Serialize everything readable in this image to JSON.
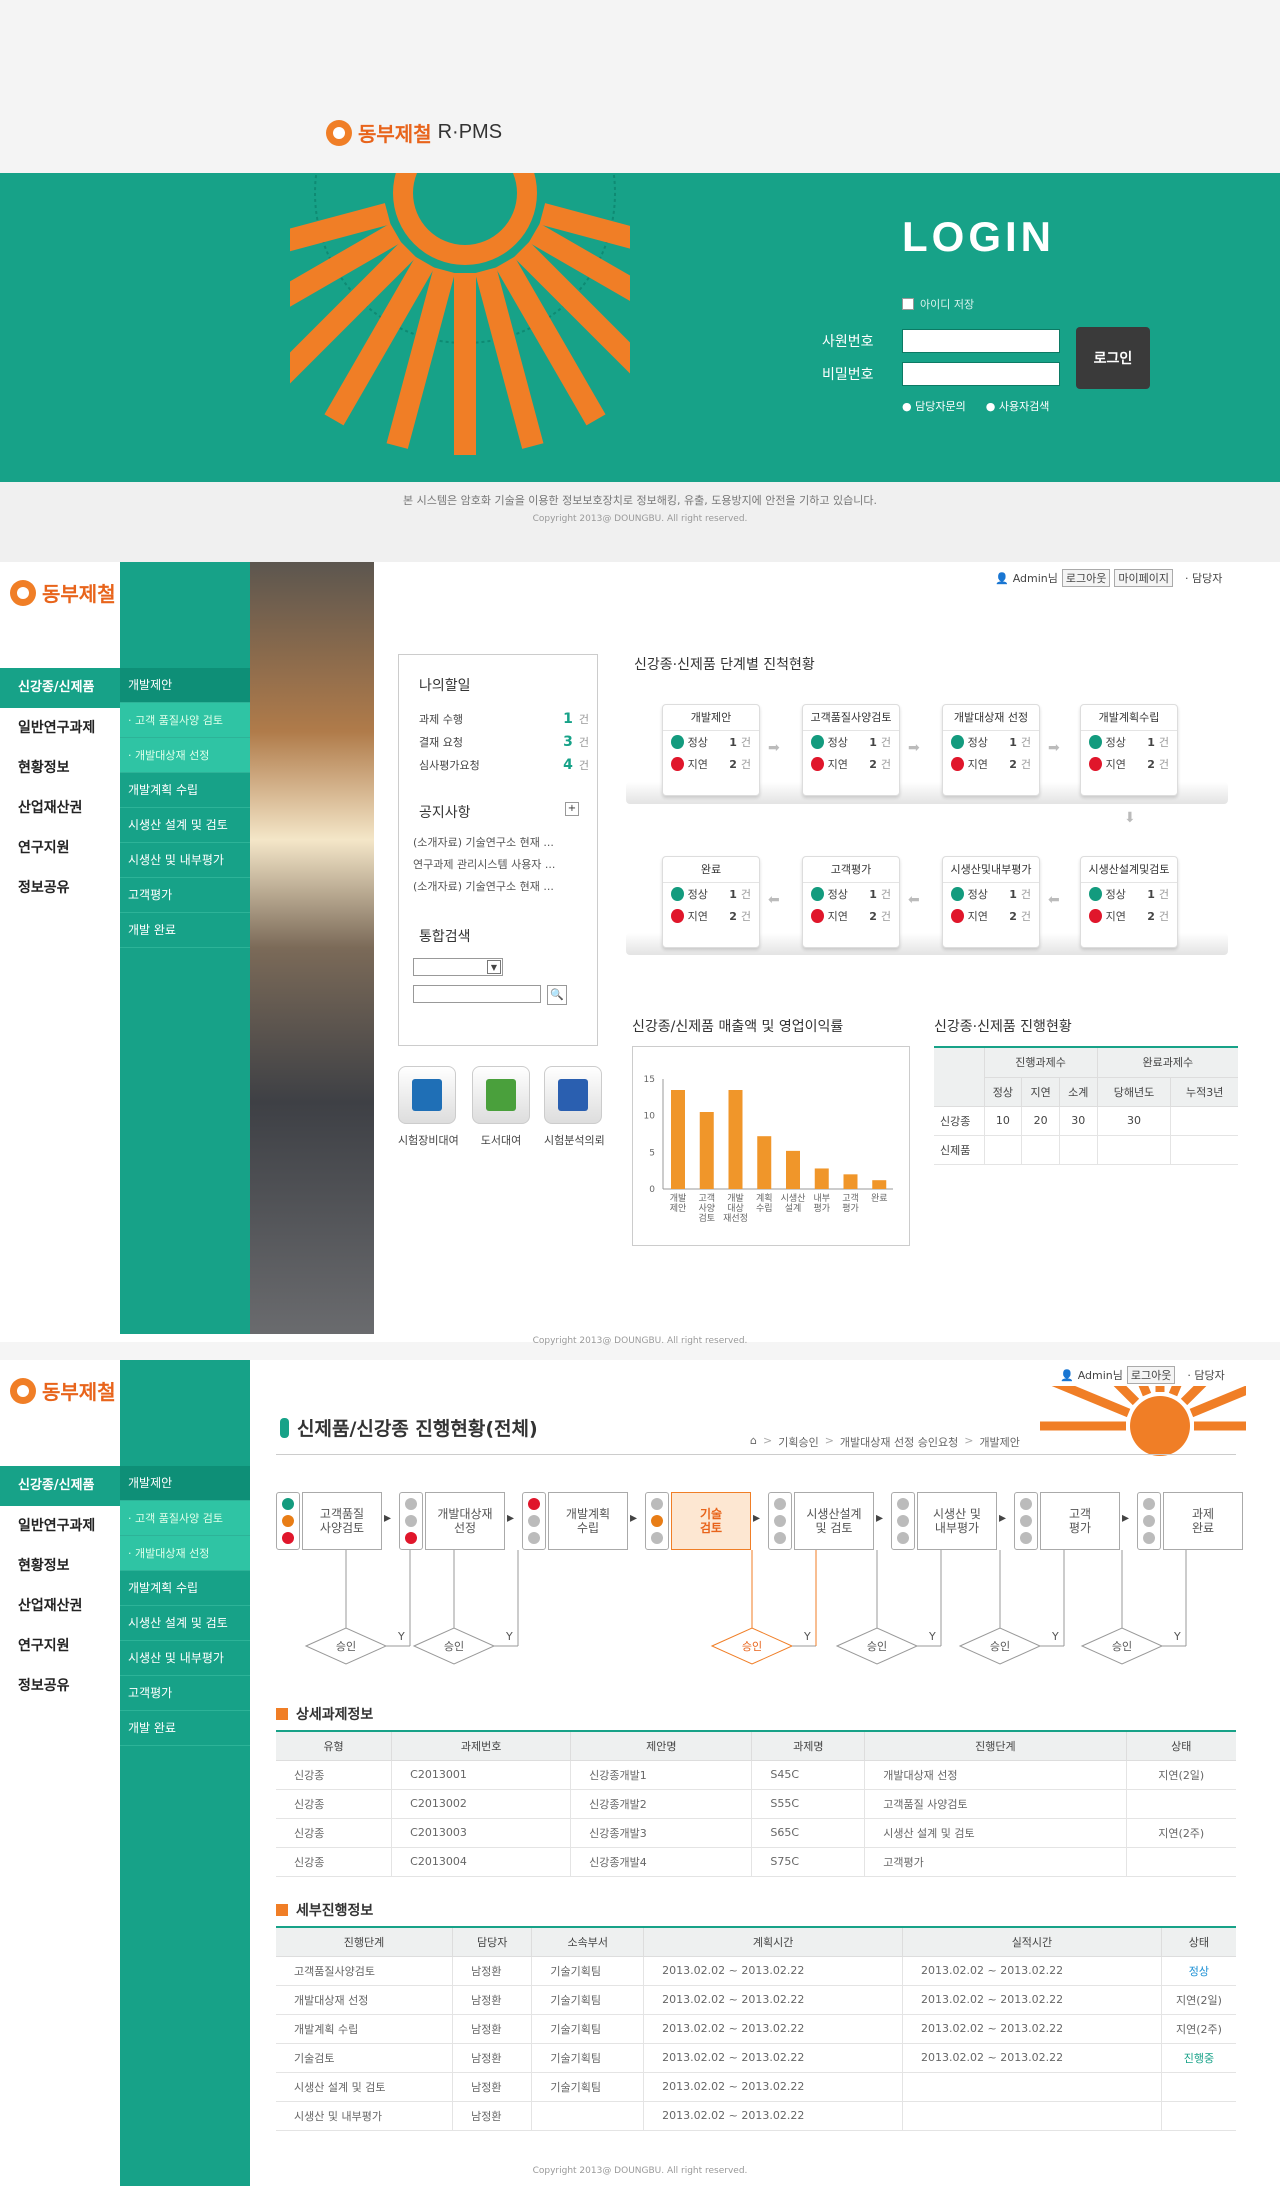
{
  "brand": {
    "name": "동부제철",
    "product": "R·PMS"
  },
  "login": {
    "title": "LOGIN",
    "save_id": "아이디 저장",
    "emp_label": "사원번호",
    "pw_label": "비밀번호",
    "login_button": "로그인",
    "contact": "담당자문의",
    "manual": "사용자검색",
    "notice": "본 시스템은 암호화 기술을 이용한 정보보호장치로 정보해킹, 유출, 도용방지에 안전을 기하고 있습니다.",
    "copyright": "Copyright 2013@ DOUNGBU. All right reserved."
  },
  "header": {
    "user": "Admin님",
    "logout": "로그아웃",
    "mypage": "마이페이지",
    "contact": "담당자"
  },
  "menu": {
    "main": [
      "신강종/신제품",
      "일반연구과제",
      "현황정보",
      "산업재산권",
      "연구지원",
      "정보공유"
    ],
    "sub": [
      "개발제안",
      "· 고객 품질사양 검토",
      "· 개발대상재 선정",
      "개발계획 수립",
      "시생산 설계 및 검토",
      "시생산 및 내부평가",
      "고객평가",
      "개발 완료"
    ]
  },
  "todo": {
    "title": "나의할일",
    "items": [
      {
        "label": "과제 수행",
        "count": "1",
        "unit": "건"
      },
      {
        "label": "결재 요청",
        "count": "3",
        "unit": "건"
      },
      {
        "label": "심사평가요청",
        "count": "4",
        "unit": "건"
      }
    ]
  },
  "notice": {
    "title": "공지사항",
    "items": [
      "(소개자료) 기술연구소 현재 ...",
      "연구과제 관리시스템 사용자 ...",
      "(소개자료) 기술연구소 현재 ..."
    ]
  },
  "search": {
    "title": "통합검색"
  },
  "quick": [
    "시험장비대여",
    "도서대여",
    "시험분석의뢰"
  ],
  "progress": {
    "title": "신강종·신제품 단계별 진척현황",
    "normal": "정상",
    "delay": "지연",
    "unit": "건",
    "row1": [
      {
        "name": "개발제안",
        "n": "1",
        "d": "2"
      },
      {
        "name": "고객품질사양검토",
        "n": "1",
        "d": "2"
      },
      {
        "name": "개발대상재 선정",
        "n": "1",
        "d": "2"
      },
      {
        "name": "개발계획수립",
        "n": "1",
        "d": "2"
      }
    ],
    "row2": [
      {
        "name": "완료",
        "n": "1",
        "d": "2"
      },
      {
        "name": "고객평가",
        "n": "1",
        "d": "2"
      },
      {
        "name": "시생산및내부평가",
        "n": "1",
        "d": "2"
      },
      {
        "name": "시생산설계및검토",
        "n": "1",
        "d": "2"
      }
    ]
  },
  "chart_data": {
    "type": "bar",
    "title": "신강종/신제품 매출액 및 영업이익률",
    "categories": [
      "개발\n제안",
      "고객\n사양\n검토",
      "개발\n대상\n재선정",
      "계획\n수립",
      "시생산\n설계",
      "내부\n평가",
      "고객\n평가",
      "완료"
    ],
    "values": [
      13.5,
      10.5,
      13.5,
      7.2,
      5.2,
      2.8,
      2.0,
      1.2
    ],
    "ylim": [
      0,
      15
    ],
    "yticks": [
      "15",
      "10",
      "5",
      "0"
    ],
    "color": "#f0962a"
  },
  "status_table": {
    "title": "신강종·신제품 진행현황",
    "head1": [
      "진행과제수",
      "완료과제수"
    ],
    "head2": [
      "정상",
      "지연",
      "소계",
      "당해년도",
      "누적3년"
    ],
    "rows": [
      {
        "label": "신강종",
        "vals": [
          "10",
          "20",
          "30",
          "30",
          ""
        ]
      },
      {
        "label": "신제품",
        "vals": [
          "",
          "",
          "",
          "",
          ""
        ]
      }
    ]
  },
  "page2": {
    "title": "신제품/신강종 진행현황(전체)",
    "breadcrumb": [
      "기획승인",
      "개발대상재 선정 승인요청",
      "개발제안"
    ],
    "flow": [
      "고객품질\n사양검토",
      "개발대상재\n선정",
      "개발계획\n수립",
      "기술\n검토",
      "시생산설계\n및 검토",
      "시생산 및\n내부평가",
      "고객\n평가",
      "과제\n완료"
    ],
    "approve": "승인",
    "yes": "Y"
  },
  "detail": {
    "title": "상세과제정보",
    "cols": [
      "유형",
      "과제번호",
      "제안명",
      "과제명",
      "진행단계",
      "상태"
    ],
    "rows": [
      [
        "신강종",
        "C2013001",
        "신강종개발1",
        "S45C",
        "개발대상재 선정",
        "지연(2일)"
      ],
      [
        "신강종",
        "C2013002",
        "신강종개발2",
        "S55C",
        "고객품질 사양검토",
        ""
      ],
      [
        "신강종",
        "C2013003",
        "신강종개발3",
        "S65C",
        "시생산 설계 및 검토",
        "지연(2주)"
      ],
      [
        "신강종",
        "C2013004",
        "신강종개발4",
        "S75C",
        "고객평가",
        ""
      ]
    ]
  },
  "stepinfo": {
    "title": "세부진행정보",
    "cols": [
      "진행단계",
      "담당자",
      "소속부서",
      "계획시간",
      "실적시간",
      "상태"
    ],
    "rows": [
      [
        "고객품질사양검토",
        "남정환",
        "기술기획팀",
        "2013.02.02 ~ 2013.02.22",
        "2013.02.02 ~ 2013.02.22",
        "정상"
      ],
      [
        "개발대상재 선정",
        "남정환",
        "기술기획팀",
        "2013.02.02 ~ 2013.02.22",
        "2013.02.02 ~ 2013.02.22",
        "지연(2일)"
      ],
      [
        "개발계획 수립",
        "남정환",
        "기술기획팀",
        "2013.02.02 ~ 2013.02.22",
        "2013.02.02 ~ 2013.02.22",
        "지연(2주)"
      ],
      [
        "기술검토",
        "남정환",
        "기술기획팀",
        "2013.02.02 ~ 2013.02.22",
        "2013.02.02 ~ 2013.02.22",
        "진행중"
      ],
      [
        "시생산 설계 및 검토",
        "남정환",
        "기술기획팀",
        "2013.02.02 ~ 2013.02.22",
        "",
        ""
      ],
      [
        "시생산 및 내부평가",
        "남정환",
        "",
        "2013.02.02 ~ 2013.02.22",
        "",
        ""
      ]
    ]
  }
}
